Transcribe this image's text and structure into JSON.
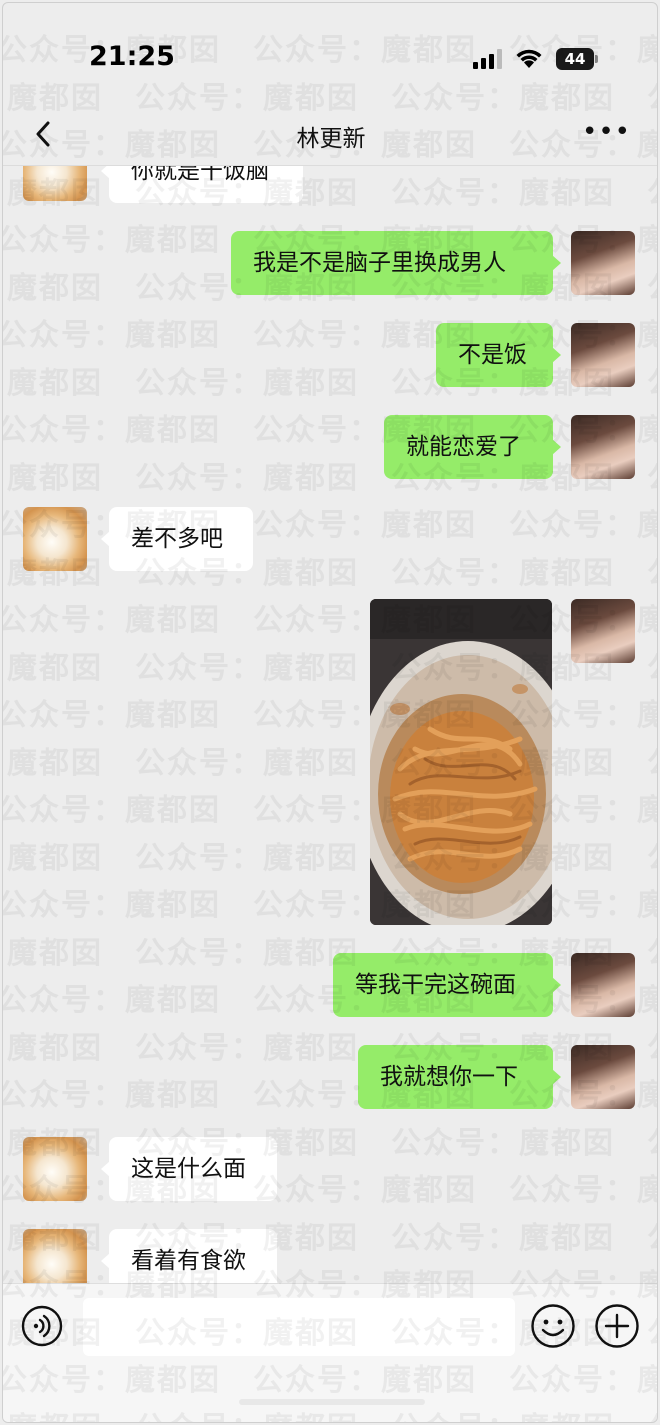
{
  "status_bar": {
    "time": "21:25",
    "battery": "44"
  },
  "header": {
    "title": "林更新"
  },
  "watermark": {
    "text": "公众号：魔都囡"
  },
  "messages": [
    {
      "from": "other",
      "text": "你就是干饭脑"
    },
    {
      "from": "self",
      "text": "我是不是脑子里换成男人"
    },
    {
      "from": "self",
      "text": "不是饭"
    },
    {
      "from": "self",
      "text": "就能恋爱了"
    },
    {
      "from": "other",
      "text": "差不多吧"
    },
    {
      "from": "self",
      "type": "image",
      "content": "bowl of noodles"
    },
    {
      "from": "self",
      "text": "等我干完这碗面"
    },
    {
      "from": "self",
      "text": "我就想你一下"
    },
    {
      "from": "other",
      "text": "这是什么面"
    },
    {
      "from": "other",
      "text": "看着有食欲"
    }
  ],
  "icons": [
    "back-icon",
    "more-icon",
    "voice-icon",
    "emoji-icon",
    "plus-icon",
    "signal-icon",
    "wifi-icon"
  ]
}
